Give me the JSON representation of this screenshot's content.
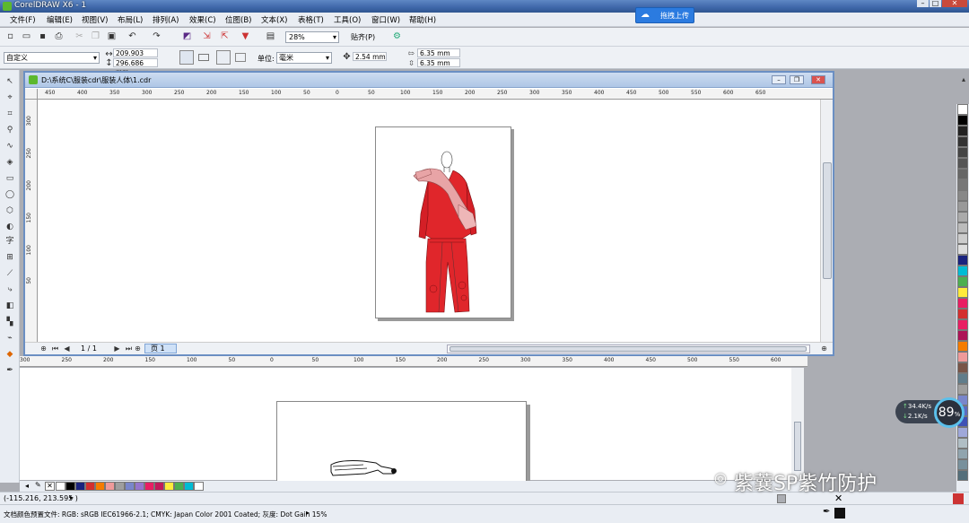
{
  "window": {
    "title": "CorelDRAW X6 - 1",
    "min_label": "–",
    "max_label": "□",
    "close_label": "✕"
  },
  "upload": {
    "label": "拖拽上传",
    "icon": "cloud-icon"
  },
  "menu": [
    "文件(F)",
    "编辑(E)",
    "视图(V)",
    "布局(L)",
    "排列(A)",
    "效果(C)",
    "位图(B)",
    "文本(X)",
    "表格(T)",
    "工具(O)",
    "窗口(W)",
    "帮助(H)"
  ],
  "toolbar": {
    "zoom": "28%",
    "snap": "贴齐(P)"
  },
  "props": {
    "page_size": "自定义",
    "width": "209.903 mm",
    "height": "296.686 mm",
    "unit_label": "单位:",
    "unit": "毫米",
    "nudge": "2.54 mm",
    "dup_x": "6.35 mm",
    "dup_y": "6.35 mm"
  },
  "document": {
    "path": "D:\\系统C\\服装cdr\\服装人体\\1.cdr",
    "page_counter": "1 / 1",
    "page_tab": "页 1"
  },
  "ruler_top": [
    "450",
    "400",
    "350",
    "300",
    "250",
    "200",
    "150",
    "100",
    "50",
    "0",
    "50",
    "100",
    "150",
    "200",
    "250",
    "300",
    "350",
    "400",
    "450",
    "500",
    "550",
    "600",
    "650"
  ],
  "ruler_left": [
    "300",
    "250",
    "200",
    "150",
    "100",
    "50"
  ],
  "ruler_bottom": [
    "300",
    "250",
    "200",
    "150",
    "100",
    "50",
    "0",
    "50",
    "100",
    "150",
    "200",
    "250",
    "300",
    "350",
    "400",
    "450",
    "500",
    "550",
    "600"
  ],
  "status": {
    "coords": "(-115.216, 213.595 )",
    "color_profile": "文档颜色预置文件: RGB: sRGB IEC61966-2.1; CMYK: Japan Color 2001 Coated; 灰度: Dot Gain 15%"
  },
  "network": {
    "up": "34.4K/s",
    "down": "2.1K/s",
    "percent": "89",
    "percent_sign": "%"
  },
  "watermark": {
    "text": "紫蘘SP紫竹防护"
  },
  "colors": {
    "accent": "#3e67a9",
    "garment_red": "#e0262b",
    "scarf_pink": "#e8a4a6",
    "palette_bottom": [
      "#ffffff",
      "#000000",
      "#1a237e",
      "#d32f2f",
      "#f57c00",
      "#ef9a9a",
      "#9e9e9e",
      "#7986cb",
      "#9575cd",
      "#e91e63",
      "#c2185b",
      "#ffeb3b",
      "#4caf50",
      "#00bcd4",
      "#ffffff"
    ],
    "palette_right": [
      "#ffffff",
      "#000000",
      "#222222",
      "#333333",
      "#444444",
      "#555555",
      "#666666",
      "#777777",
      "#888888",
      "#999999",
      "#aaaaaa",
      "#bbbbbb",
      "#cccccc",
      "#dddddd",
      "#1a237e",
      "#00bcd4",
      "#4caf50",
      "#ffeb3b",
      "#e91e63",
      "#d32f2f",
      "#e91e63",
      "#ad1457",
      "#f57c00",
      "#ef9a9a",
      "#795548",
      "#607d8b",
      "#9e9e9e",
      "#7986cb",
      "#5c6bc0",
      "#3f51b5",
      "#9fa8da",
      "#b0bec5",
      "#90a4ae",
      "#78909c",
      "#546e7a"
    ]
  }
}
